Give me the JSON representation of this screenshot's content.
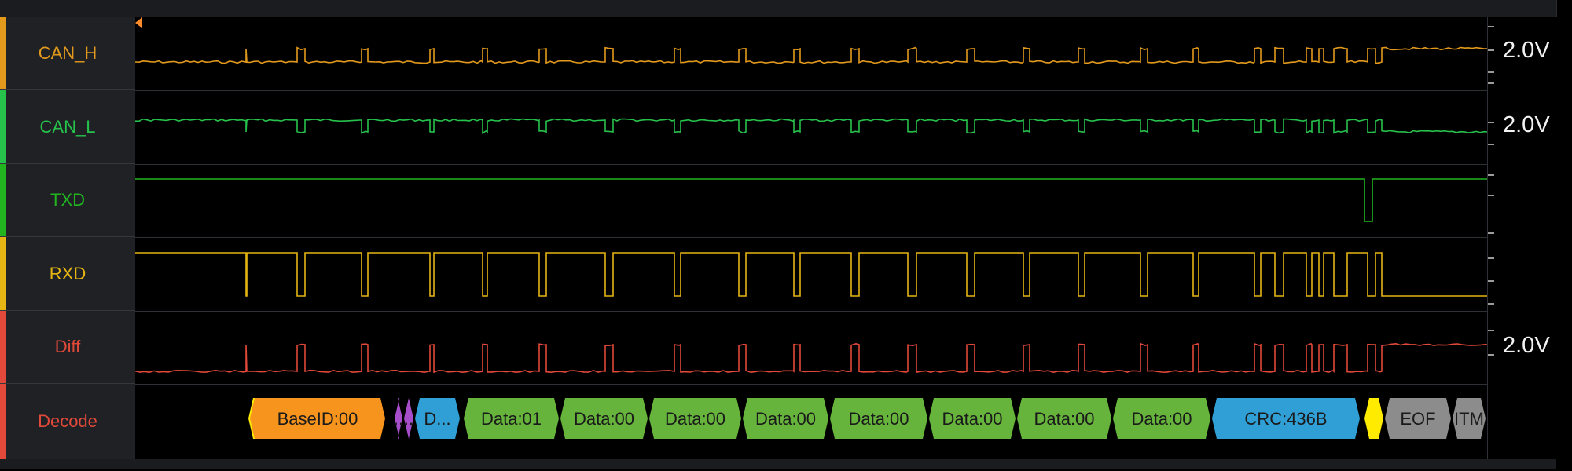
{
  "channels": [
    {
      "label": "CAN_H",
      "color": "#e39a1c",
      "stripe": "#e39a1c",
      "scale": "2.0V"
    },
    {
      "label": "CAN_L",
      "color": "#27c24c",
      "stripe": "#27c24c",
      "scale": "2.0V"
    },
    {
      "label": "TXD",
      "color": "#22b520",
      "stripe": "#22b520",
      "scale": ""
    },
    {
      "label": "RXD",
      "color": "#e5b514",
      "stripe": "#e5b514",
      "scale": ""
    },
    {
      "label": "Diff",
      "color": "#e2493a",
      "stripe": "#e2493a",
      "scale": "2.0V"
    },
    {
      "label": "Decode",
      "color": "#e2493a",
      "stripe": "#e2493a",
      "scale": ""
    }
  ],
  "decode": {
    "frames": [
      {
        "label": "BaseID:00",
        "color": "#f7941d"
      },
      {
        "label": "..",
        "color": "#a64dc9"
      },
      {
        "label": "D...",
        "color": "#2f9fd6"
      },
      {
        "label": "Data:01",
        "color": "#66b43c"
      },
      {
        "label": "Data:00",
        "color": "#66b43c"
      },
      {
        "label": "Data:00",
        "color": "#66b43c"
      },
      {
        "label": "Data:00",
        "color": "#66b43c"
      },
      {
        "label": "Data:00",
        "color": "#66b43c"
      },
      {
        "label": "Data:00",
        "color": "#66b43c"
      },
      {
        "label": "Data:00",
        "color": "#66b43c"
      },
      {
        "label": "Data:00",
        "color": "#66b43c"
      },
      {
        "label": "CRC:436B",
        "color": "#2f9fd6"
      },
      {
        "label": "",
        "color": "#ffeb00"
      },
      {
        "label": "EOF",
        "color": "#8c8c8c"
      },
      {
        "label": "ITM",
        "color": "#8c8c8c"
      }
    ]
  }
}
